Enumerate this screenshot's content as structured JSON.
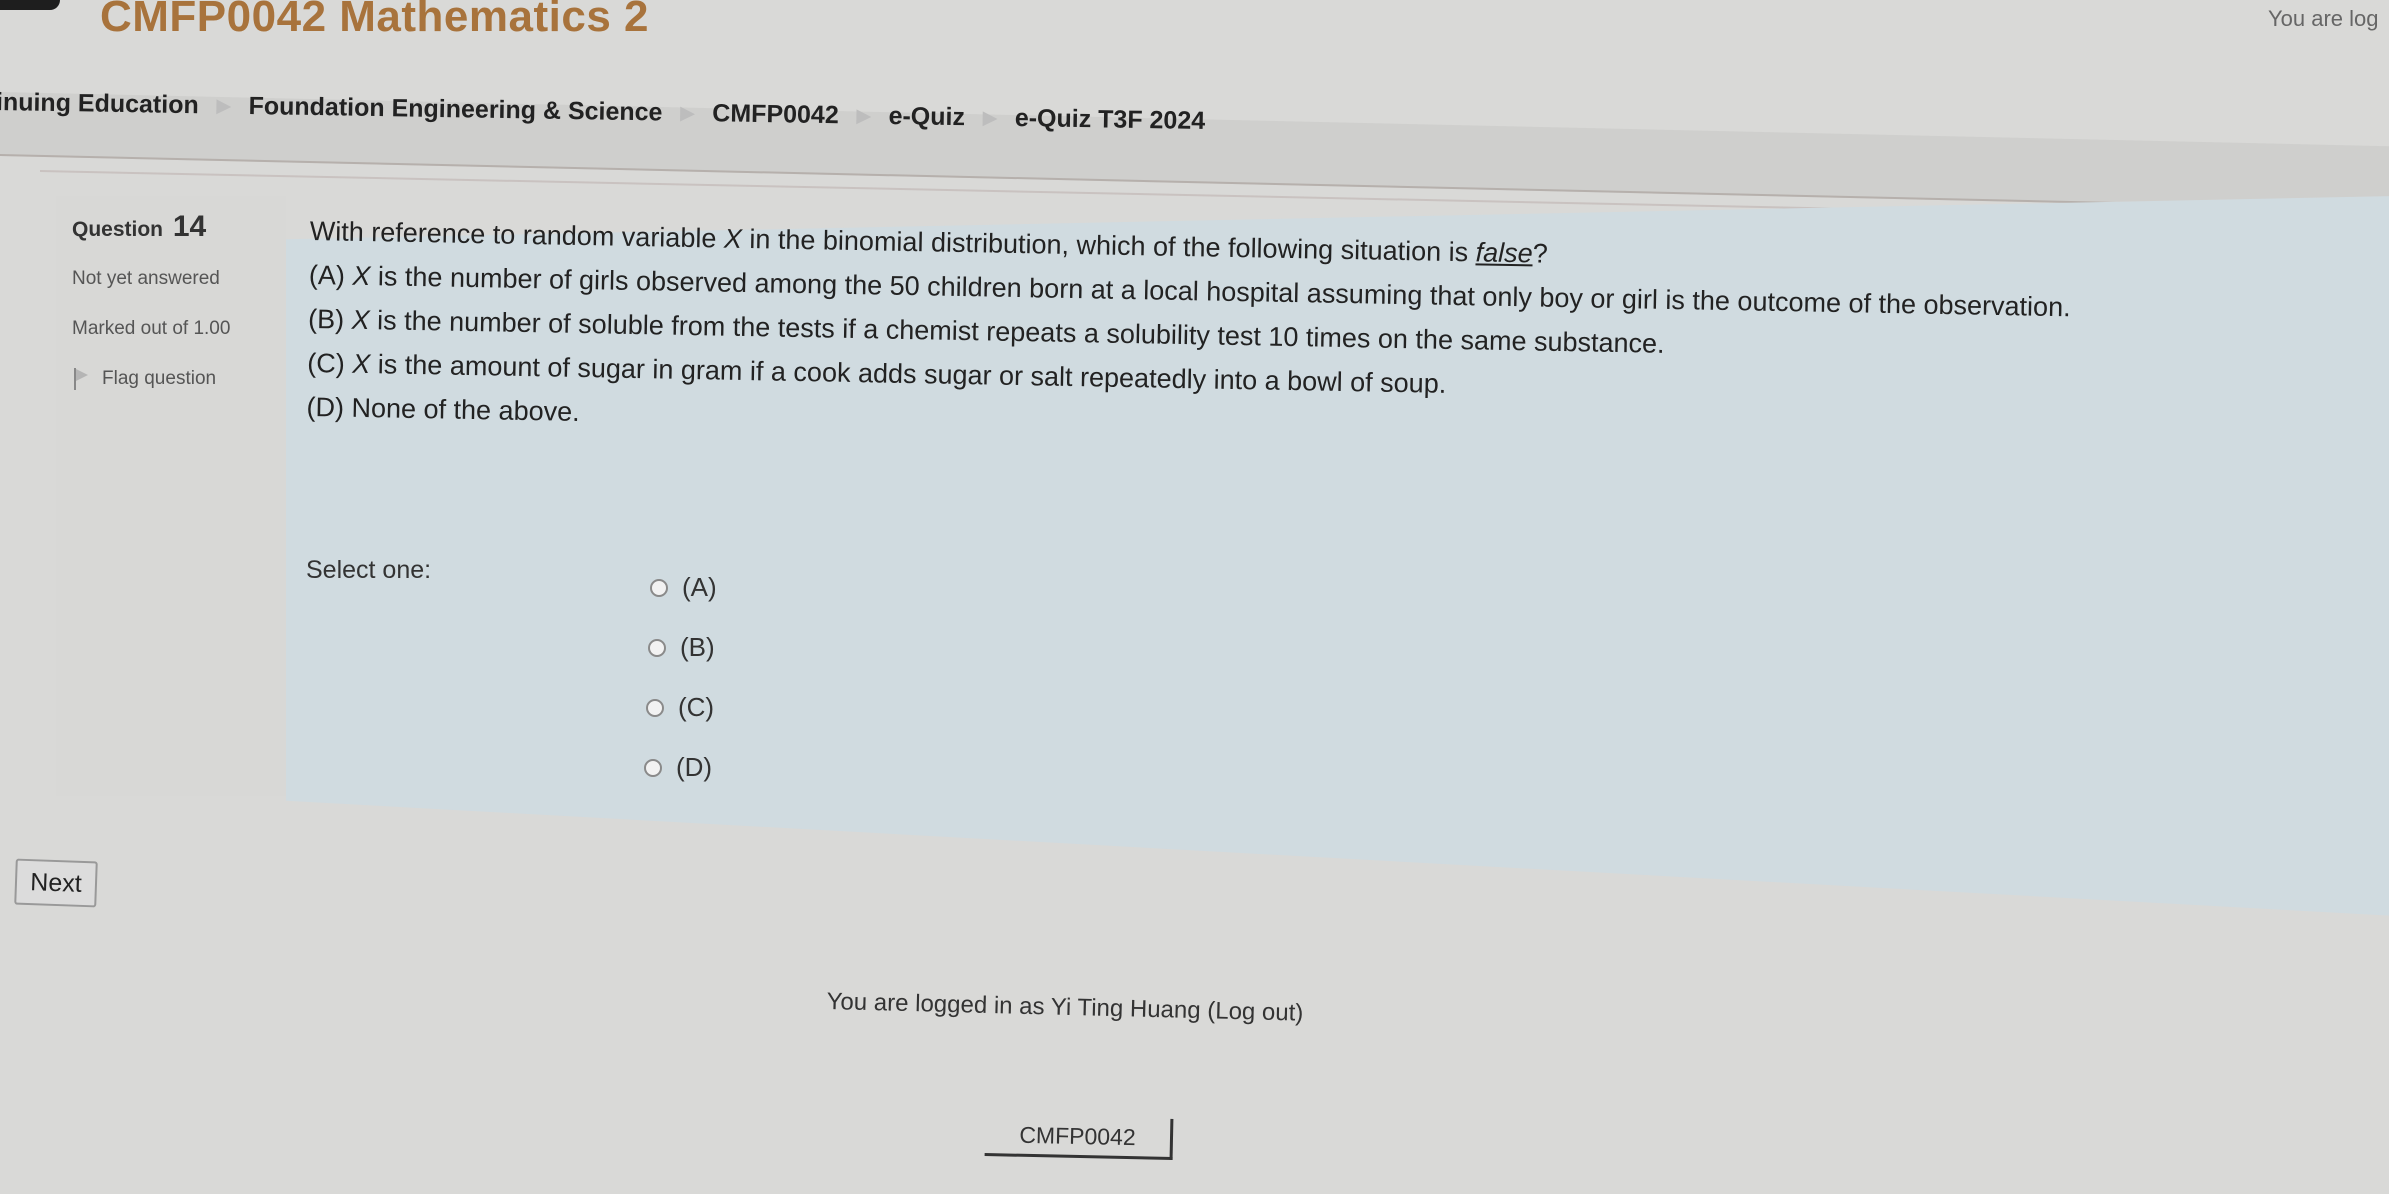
{
  "header": {
    "site_title": "CMFP0042 Mathematics 2",
    "login_info_top": "You are log"
  },
  "breadcrumb": [
    {
      "label": "inuing Education"
    },
    {
      "label": "Foundation Engineering & Science"
    },
    {
      "label": "CMFP0042"
    },
    {
      "label": "e-Quiz"
    },
    {
      "label": "e-Quiz T3F 2024"
    }
  ],
  "breadcrumb_separator": "▶",
  "question_info": {
    "label": "Question",
    "number": "14",
    "state": "Not yet answered",
    "grade": "Marked out of 1.00",
    "flag_label": "Flag question"
  },
  "question": {
    "stem_before": "With reference to random variable ",
    "stem_var": "X",
    "stem_middle": " in the binomial distribution, which of the following situation is ",
    "stem_emph": "false",
    "stem_after": "?",
    "options": [
      {
        "prefix": "(A) ",
        "var": "X",
        "text": " is the number of girls observed among the 50 children born at a local hospital assuming that only boy or girl is the outcome of the observation."
      },
      {
        "prefix": "(B) ",
        "var": "X",
        "text": " is the number of soluble from the tests if a chemist repeats a solubility test 10 times on the same substance."
      },
      {
        "prefix": "(C) ",
        "var": "X",
        "text": " is the amount of sugar in gram if a cook adds sugar or salt repeatedly into a bowl of soup."
      },
      {
        "prefix": "(D) ",
        "var": "",
        "text": "None of the above."
      }
    ],
    "select_prompt": "Select one:",
    "answers": [
      {
        "label": "(A)",
        "selected": false
      },
      {
        "label": "(B)",
        "selected": false
      },
      {
        "label": "(C)",
        "selected": false
      },
      {
        "label": "(D)",
        "selected": false
      }
    ]
  },
  "navigation": {
    "next_label": "Next"
  },
  "footer": {
    "login_prefix": "You are logged in as ",
    "user_name": "Yi Ting Huang",
    "logout_label": "(Log out)",
    "course_link": "CMFP0042"
  },
  "colors": {
    "title": "#a8733c",
    "panel": "#d0dbe0",
    "page_bg": "#d9d9d7"
  }
}
